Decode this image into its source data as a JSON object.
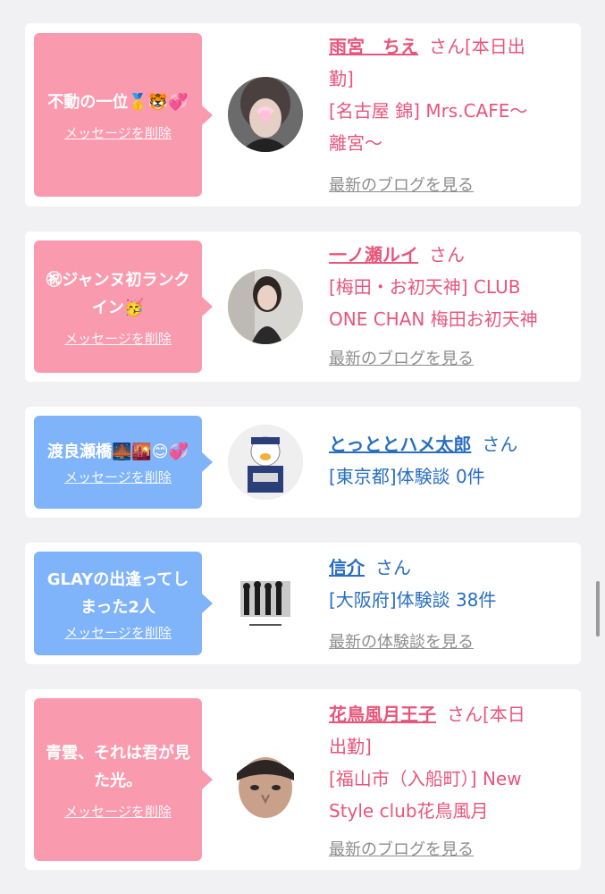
{
  "items": [
    {
      "message": "不動の一位🥇🐯💞",
      "delete_label": "メッセージを削除",
      "name": "雨宮　ちえ",
      "san": "さん",
      "info_lines": [
        "[本日出勤]",
        "[名古屋 錦] Mrs.CAFE〜離宮〜"
      ],
      "info_head": "[本日出",
      "info_1": "勤]",
      "info_2": "[名古屋 錦] Mrs.CAFE〜",
      "info_3": "離宮〜",
      "link": "最新のブログを見る",
      "bubble_color": "#fa9aae",
      "text_color": "#e8557b"
    },
    {
      "message": "㊗ジャンヌ初ランクイン🥳",
      "delete_label": "メッセージを削除",
      "name": "一ノ瀬ルイ",
      "san": "さん",
      "info_1": "[梅田・お初天神] CLUB",
      "info_2": "ONE CHAN 梅田お初天神",
      "link": "最新のブログを見る",
      "bubble_color": "#fa9aae",
      "text_color": "#e8557b"
    },
    {
      "message": "渡良瀬橋🌉🌇😊💞",
      "delete_label": "メッセージを削除",
      "name": "とっととハメ太郎",
      "san": "さん",
      "info_1": "[東京都]体験談 0件",
      "bubble_color": "#7fb3fa",
      "text_color": "#2a6fbf"
    },
    {
      "message": "GLAYの出逢ってしまった2人",
      "delete_label": "メッセージを削除",
      "name": "信介",
      "san": "さん",
      "info_1": "[大阪府]体験談 38件",
      "link": "最新の体験談を見る",
      "bubble_color": "#7fb3fa",
      "text_color": "#2a6fbf"
    },
    {
      "message": "青雲、それは君が見た光。",
      "delete_label": "メッセージを削除",
      "name": "花鳥風月王子",
      "san": "さん",
      "info_head": "[本日",
      "info_1": "出勤]",
      "info_2": "[福山市（入船町）] New",
      "info_3": "Style club花鳥風月",
      "link": "最新のブログを見る",
      "bubble_color": "#fa9aae",
      "text_color": "#e8557b"
    }
  ]
}
